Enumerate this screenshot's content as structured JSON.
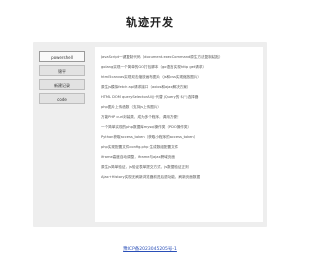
{
  "header": {
    "title": "轨迹开发"
  },
  "sidebar": {
    "items": [
      {
        "label": "powershell"
      },
      {
        "label": "锦平"
      },
      {
        "label": "新建记录"
      },
      {
        "label": "code"
      }
    ]
  },
  "main": {
    "links": [
      "JavaScript一键复制代码（document.execCommand原生方法复制粘贴）",
      "golang实现一个简单的GO打包脚本（go语言实现http get请求）",
      "html5canvas实现双击缩放画布图片（js和css实现缩放图片）",
      "原生js模拟fetch api请求接口（axios和ajax解决方案）",
      "HTML DOM querySelectorAll()·代替 jQuery的 $('')选择器",
      "php图片上传函数（支持js上传图片）",
      "万能PHP curl封装类，成为多个程序，调用方便！",
      "一个简单实现的php数据库mysql操作类（PDO操作类）",
      "Python获取access_token（获取小程序的access_token）",
      "php实现配置文件config.php 生成数组配置文件",
      "iframe高度自动调整，iframe与ajax跨域页面",
      "原生js简单验证，js验证表单提交方式，js数据验证正则",
      "Ajax+History实现无刷新浏览器前进后退功能，刷新页面数据"
    ]
  },
  "footer": {
    "link": "豫ICP备2023045205号-1"
  }
}
